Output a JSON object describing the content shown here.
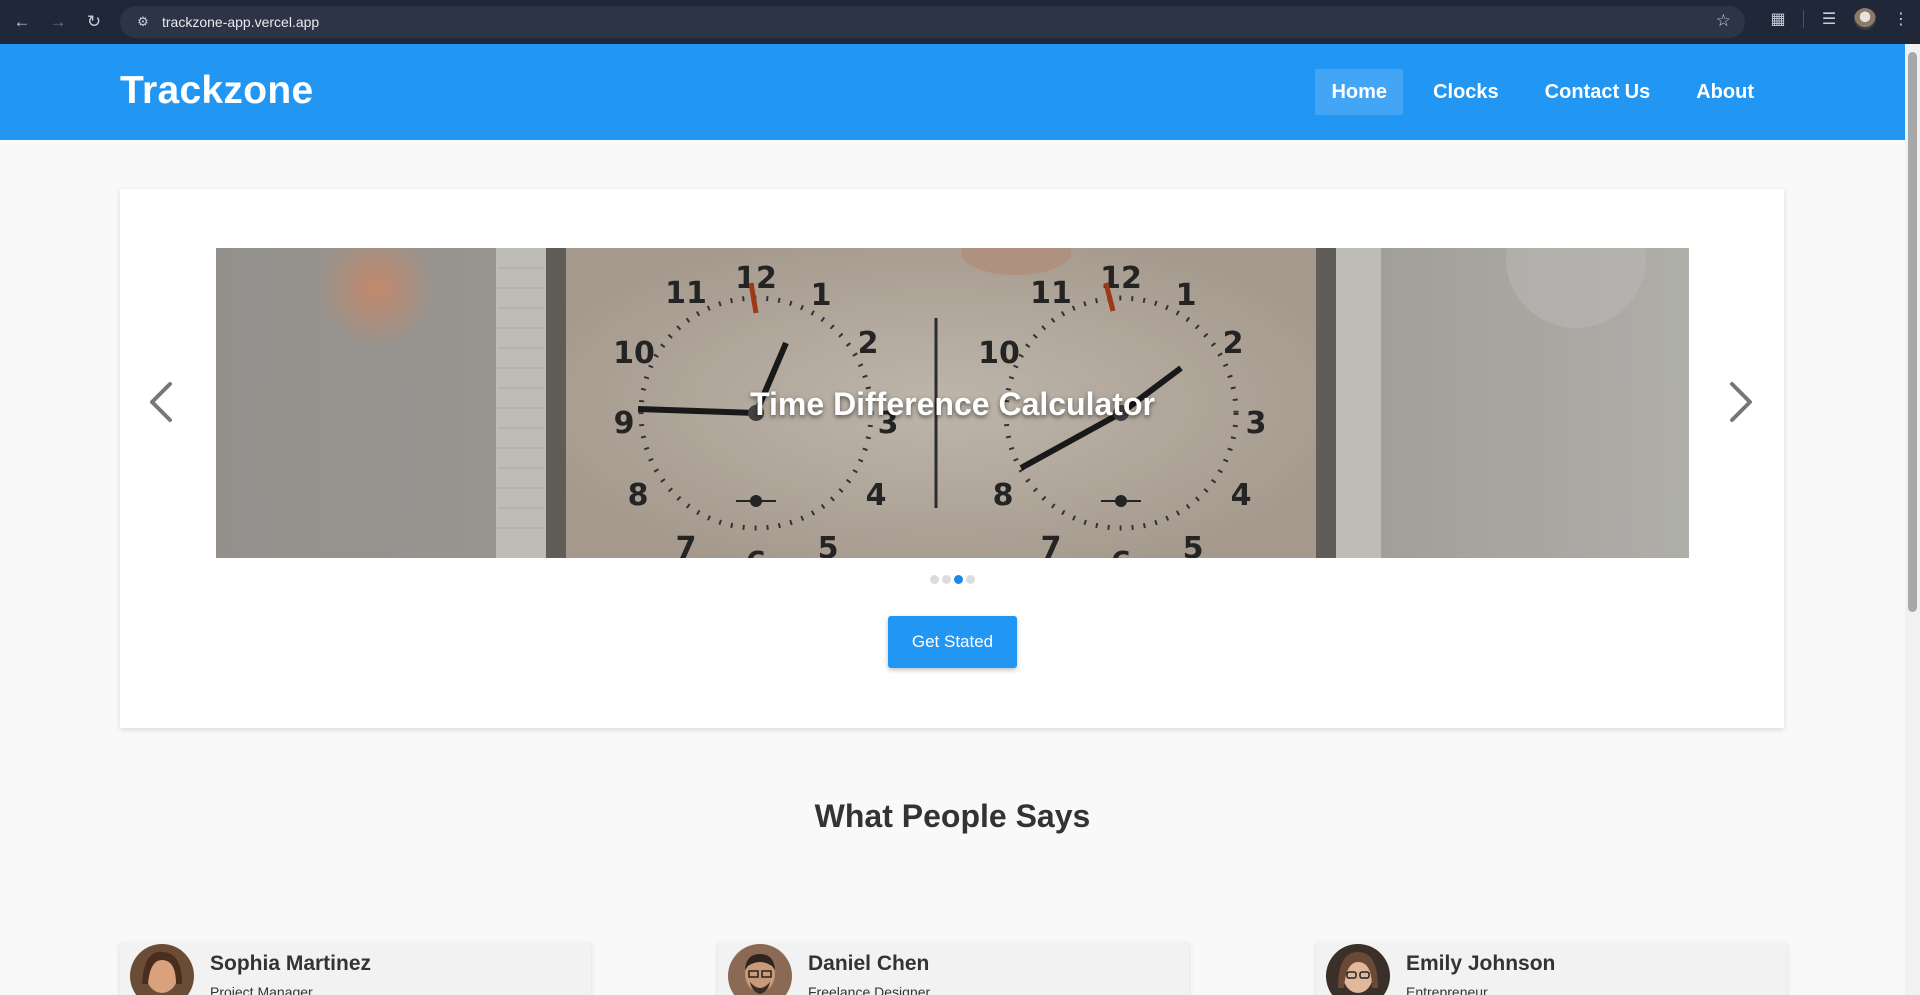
{
  "browser": {
    "url": "trackzone-app.vercel.app",
    "icons": [
      "back-arrow-icon",
      "forward-arrow-icon",
      "reload-icon",
      "site-settings-icon",
      "bookmark-star-icon",
      "extensions-icon",
      "media-controls-icon",
      "profile-avatar-icon",
      "kebab-menu-icon"
    ]
  },
  "header": {
    "brand": "Trackzone",
    "nav": [
      {
        "label": "Home",
        "active": true
      },
      {
        "label": "Clocks",
        "active": false
      },
      {
        "label": "Contact Us",
        "active": false
      },
      {
        "label": "About",
        "active": false
      }
    ],
    "color": "#2196f3"
  },
  "hero": {
    "slide_title": "Time Difference Calculator",
    "slide_count": 4,
    "active_slide": 3,
    "cta_label": "Get Stated"
  },
  "testimonials": {
    "title": "What People Says",
    "items": [
      {
        "name": "Sophia Martinez",
        "role": "Project Manager"
      },
      {
        "name": "Daniel Chen",
        "role": "Freelance Designer"
      },
      {
        "name": "Emily Johnson",
        "role": "Entrepreneur"
      }
    ]
  }
}
